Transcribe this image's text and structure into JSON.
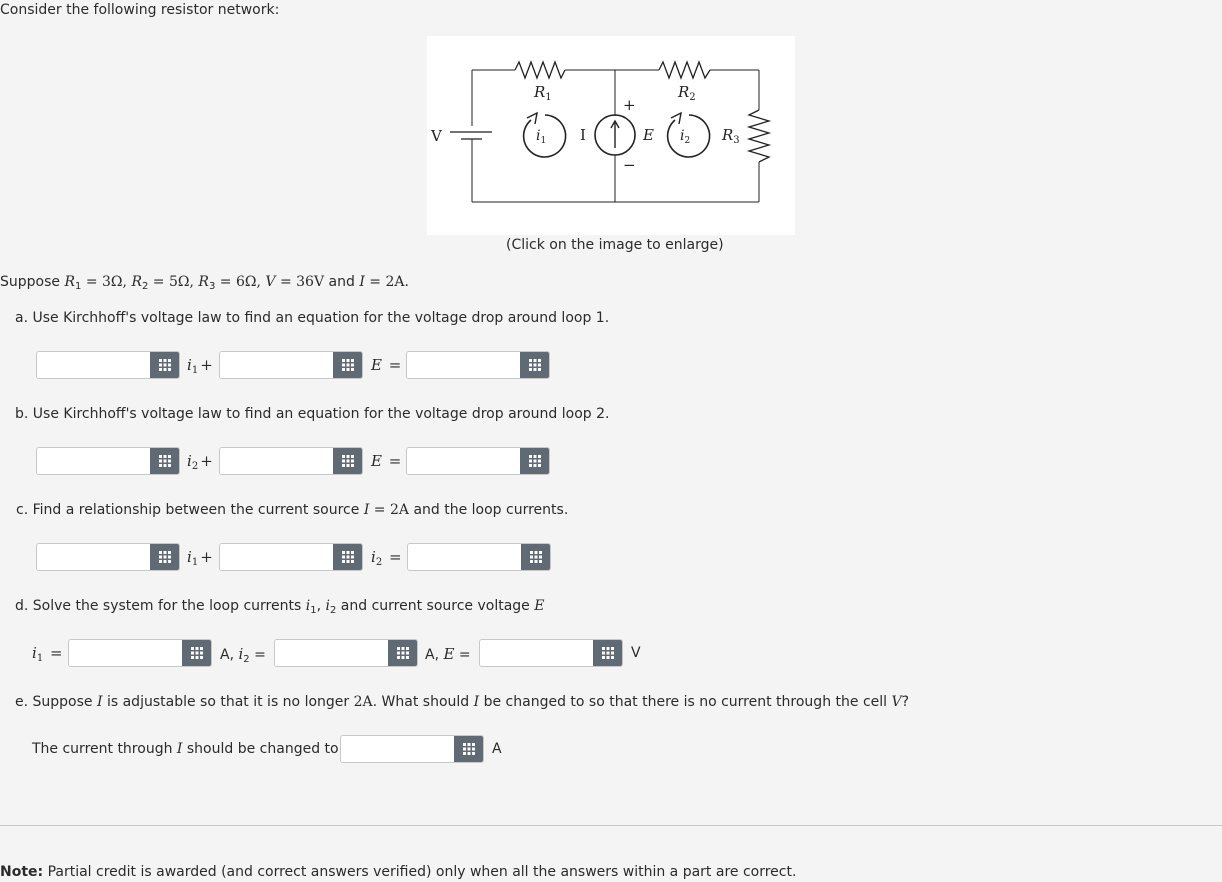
{
  "intro": "Consider the following resistor network:",
  "figure": {
    "caption": "(Click on the image to enlarge)",
    "labels": {
      "V": "V",
      "I": "I",
      "R1": "R",
      "R2": "R",
      "R3": "R",
      "sub1": "1",
      "sub2": "2",
      "sub3": "3",
      "E": "E",
      "i1": "i",
      "i2": "i",
      "plus": "+",
      "minus": "−"
    }
  },
  "given": {
    "prefix": "Suppose ",
    "r1": "R",
    "r1_sub": "1",
    "r1_val": " = 3Ω, ",
    "r2": "R",
    "r2_sub": "2",
    "r2_val": " = 5Ω, ",
    "r3": "R",
    "r3_sub": "3",
    "r3_val": " = 6Ω, ",
    "v": "V",
    "v_val": " = 36V",
    "and": " and ",
    "i": "I",
    "i_val": " = 2A."
  },
  "parts": {
    "a": {
      "label": "a. Use Kirchhoff's voltage law to find an equation for the voltage drop around loop 1.",
      "term1": "i",
      "term1_sub": "1",
      "term1_op": "+",
      "term2": "E",
      "term2_op": " ="
    },
    "b": {
      "label": "b. Use Kirchhoff's voltage law to find an equation for the voltage drop around loop 2.",
      "term1": "i",
      "term1_sub": "2",
      "term1_op": "+",
      "term2": "E",
      "term2_op": " ="
    },
    "c": {
      "label_pre": "c. Find a relationship between the current source ",
      "label_math": "I",
      "label_val": " = 2A",
      "label_post": " and the loop currents.",
      "term1": "i",
      "term1_sub": "1",
      "term1_op": "+",
      "term2": "i",
      "term2_sub": "2",
      "term2_op": " ="
    },
    "d": {
      "label_pre": "d. Solve the system for the loop currents ",
      "i1": "i",
      "i1_sub": "1",
      "comma": ", ",
      "i2": "i",
      "i2_sub": "2",
      "label_post": " and current source voltage ",
      "E": "E",
      "lead": "i",
      "lead_sub": "1",
      "lead_op": " =",
      "unit1": "A, ",
      "mid_i": "i",
      "mid_sub": "2",
      "mid_op": " =",
      "unit2": "A, ",
      "mid_E": "E",
      "mid_E_op": " =",
      "unit3": "V"
    },
    "e": {
      "label_pre": "e. Suppose ",
      "I": "I",
      "label_mid": " is adjustable so that it is no longer ",
      "val": "2A",
      "label_mid2": ". What should ",
      "I2": "I",
      "label_mid3": " be changed to so that there is no current through the cell ",
      "V": "V",
      "label_end": "?",
      "answer_pre": "The current through ",
      "answer_I": "I",
      "answer_post": " should be changed to",
      "unit": "A"
    }
  },
  "note": {
    "bold": "Note:",
    "text": " Partial credit is awarded (and correct answers verified) only when all the answers within a part are correct."
  },
  "inputs": {
    "a1": "",
    "a2": "",
    "a3": "",
    "b1": "",
    "b2": "",
    "b3": "",
    "c1": "",
    "c2": "",
    "c3": "",
    "d1": "",
    "d2": "",
    "d3": "",
    "e1": ""
  },
  "colors": {
    "button": "#606a75",
    "background": "#f4f4f4"
  },
  "icons": {
    "calc_button": "grid-icon"
  }
}
